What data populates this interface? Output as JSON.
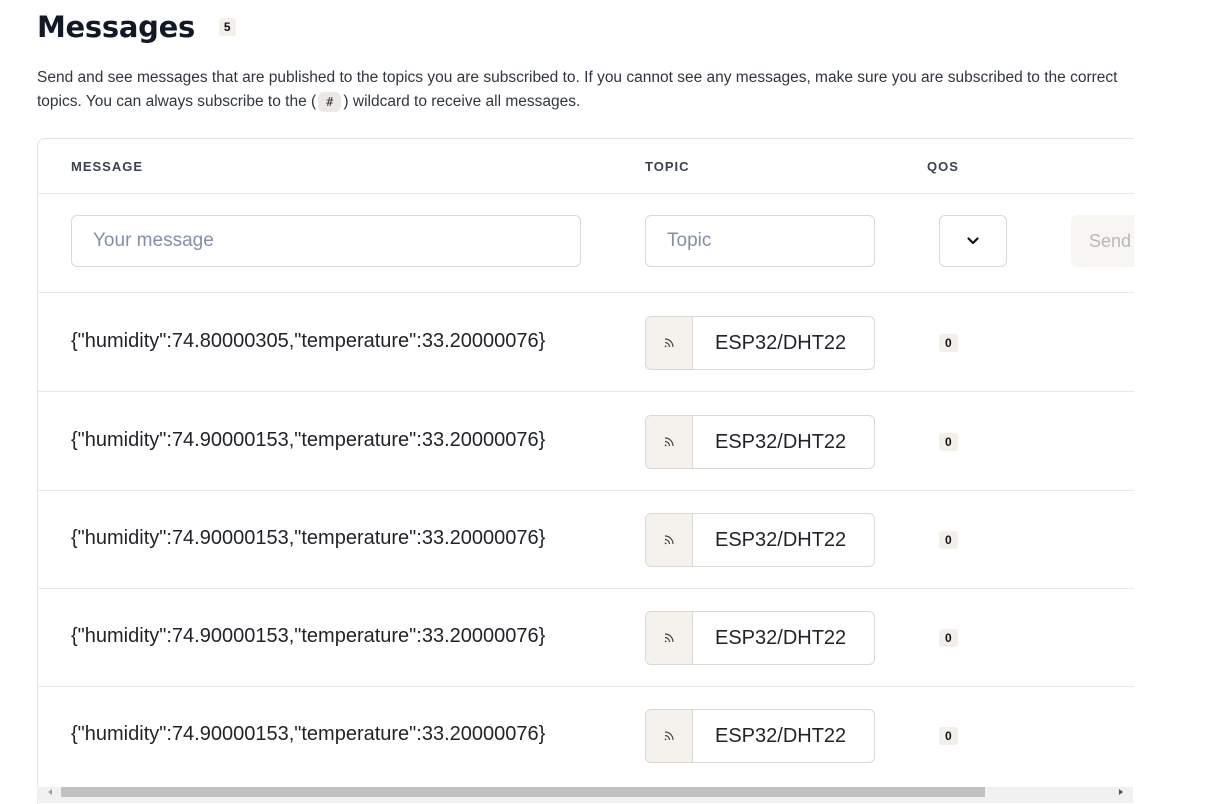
{
  "header": {
    "title": "Messages",
    "count": "5"
  },
  "description": {
    "text_before": "Send and see messages that are published to the topics you are subscribed to. If you cannot see any messages, make sure you are subscribed to the correct topics. You can always subscribe to the (",
    "wildcard": "#",
    "text_after": ") wildcard to receive all messages."
  },
  "table": {
    "columns": [
      "MESSAGE",
      "TOPIC",
      "QOS"
    ],
    "composer": {
      "message_placeholder": "Your message",
      "topic_placeholder": "Topic",
      "qos_icon": "chevron-down-icon",
      "send_label": "Send"
    },
    "rows": [
      {
        "message": "{\"humidity\":74.80000305,\"temperature\":33.20000076}",
        "topic": "ESP32/DHT22",
        "topic_icon": "rss-icon",
        "qos": "0"
      },
      {
        "message": "{\"humidity\":74.90000153,\"temperature\":33.20000076}",
        "topic": "ESP32/DHT22",
        "topic_icon": "rss-icon",
        "qos": "0"
      },
      {
        "message": "{\"humidity\":74.90000153,\"temperature\":33.20000076}",
        "topic": "ESP32/DHT22",
        "topic_icon": "rss-icon",
        "qos": "0"
      },
      {
        "message": "{\"humidity\":74.90000153,\"temperature\":33.20000076}",
        "topic": "ESP32/DHT22",
        "topic_icon": "rss-icon",
        "qos": "0"
      },
      {
        "message": "{\"humidity\":74.90000153,\"temperature\":33.20000076}",
        "topic": "ESP32/DHT22",
        "topic_icon": "rss-icon",
        "qos": "0"
      }
    ]
  }
}
